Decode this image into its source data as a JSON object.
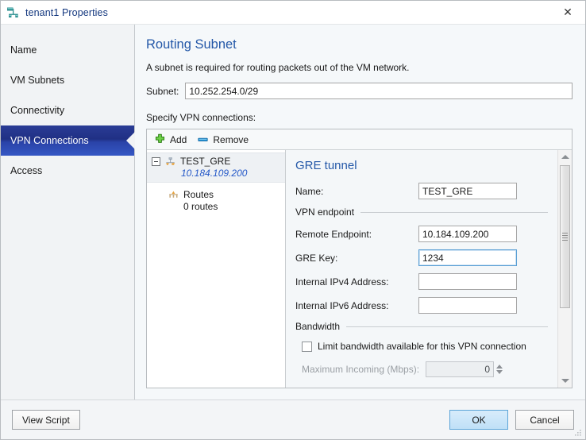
{
  "window": {
    "title": "tenant1 Properties",
    "icon": "network-subnet-icon",
    "close_label": "✕"
  },
  "sidebar": {
    "items": [
      {
        "label": "Name",
        "selected": false
      },
      {
        "label": "VM Subnets",
        "selected": false
      },
      {
        "label": "Connectivity",
        "selected": false
      },
      {
        "label": "VPN Connections",
        "selected": true
      },
      {
        "label": "Access",
        "selected": false
      }
    ]
  },
  "content": {
    "page_title": "Routing Subnet",
    "page_description": "A subnet is required for routing packets out of the VM network.",
    "subnet_label": "Subnet:",
    "subnet_value": "10.252.254.0/29",
    "specify_label": "Specify VPN connections:"
  },
  "toolbar": {
    "add_label": "Add",
    "add_icon": "plus-icon",
    "remove_label": "Remove",
    "remove_icon": "minus-icon"
  },
  "tree": {
    "root": {
      "label": "TEST_GRE",
      "sub": "10.184.109.200",
      "icon": "vpn-tunnel-icon",
      "expanded": true,
      "selected": true
    },
    "child": {
      "label": "Routes",
      "sub": "0 routes",
      "icon": "routes-icon"
    }
  },
  "detail": {
    "title": "GRE tunnel",
    "name_label": "Name:",
    "name_value": "TEST_GRE",
    "endpoint_group": "VPN endpoint",
    "remote_endpoint_label": "Remote Endpoint:",
    "remote_endpoint_value": "10.184.109.200",
    "gre_key_label": "GRE Key:",
    "gre_key_value": "1234",
    "internal_ipv4_label": "Internal IPv4 Address:",
    "internal_ipv4_value": "",
    "internal_ipv6_label": "Internal IPv6 Address:",
    "internal_ipv6_value": "",
    "bandwidth_group": "Bandwidth",
    "limit_checkbox_label": "Limit bandwidth available for this VPN connection",
    "limit_checked": false,
    "max_incoming_label": "Maximum Incoming (Mbps):",
    "max_incoming_value": "0",
    "max_incoming_disabled": true
  },
  "footer": {
    "view_script_label": "View Script",
    "ok_label": "OK",
    "cancel_label": "Cancel"
  },
  "colors": {
    "accent_heading": "#2458a8",
    "selected_nav": "#203084",
    "tree_sub": "#2458c8",
    "title_text": "#14387f"
  }
}
